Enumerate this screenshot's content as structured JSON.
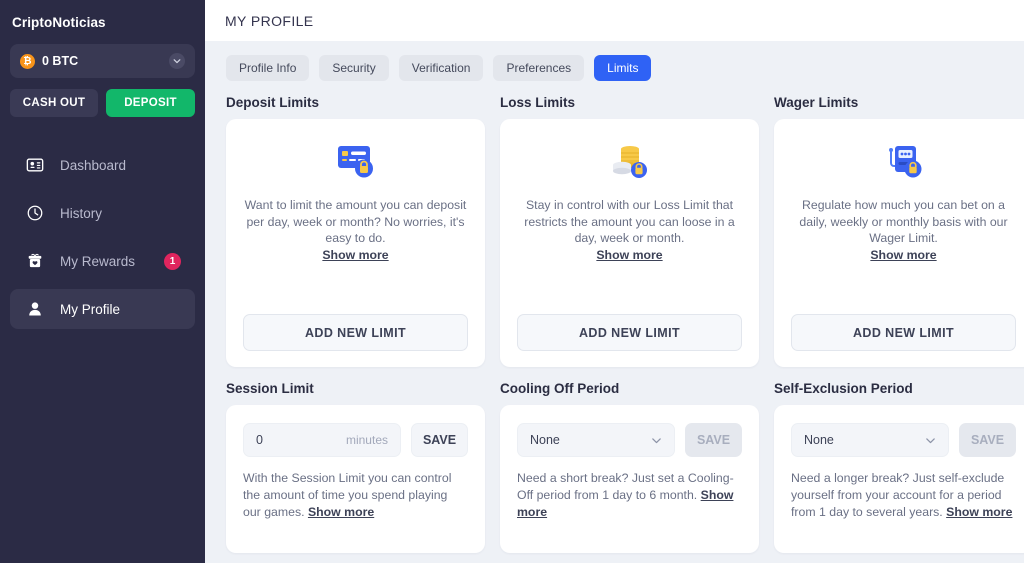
{
  "sidebar": {
    "brand": "CriptoNoticias",
    "balance": {
      "amount": "0 BTC",
      "coin_symbol": "₿",
      "chevron": "chevron-down-icon"
    },
    "actions": {
      "cash_out": "CASH OUT",
      "deposit": "DEPOSIT"
    },
    "items": [
      {
        "label": "Dashboard",
        "icon": "dashboard-icon",
        "active": false,
        "badge": ""
      },
      {
        "label": "History",
        "icon": "clock-icon",
        "active": false,
        "badge": ""
      },
      {
        "label": "My Rewards",
        "icon": "gift-icon",
        "active": false,
        "badge": "1"
      },
      {
        "label": "My Profile",
        "icon": "user-icon",
        "active": true,
        "badge": ""
      }
    ]
  },
  "header": {
    "title": "MY PROFILE"
  },
  "tabs": [
    {
      "label": "Profile Info",
      "active": false
    },
    {
      "label": "Security",
      "active": false
    },
    {
      "label": "Verification",
      "active": false
    },
    {
      "label": "Preferences",
      "active": false
    },
    {
      "label": "Limits",
      "active": true
    }
  ],
  "top_cards": [
    {
      "title": "Deposit Limits",
      "icon": "credit-card-lock-icon",
      "blurb": "Want to limit the amount you can deposit per day, week or month? No worries, it's easy to do.",
      "show_more": "Show more",
      "button": "ADD NEW LIMIT"
    },
    {
      "title": "Loss Limits",
      "icon": "coins-lock-icon",
      "blurb": "Stay in control with our Loss Limit that restricts the amount you can loose in a day, week or month.",
      "show_more": "Show more",
      "button": "ADD NEW LIMIT"
    },
    {
      "title": "Wager Limits",
      "icon": "slot-machine-lock-icon",
      "blurb": "Regulate how much you can bet on a daily, weekly or monthly basis with our Wager Limit.",
      "show_more": "Show more",
      "button": "ADD NEW LIMIT"
    }
  ],
  "bottom_cards": [
    {
      "title": "Session Limit",
      "control": "input",
      "value": "0",
      "unit": "minutes",
      "save_label": "SAVE",
      "save_disabled": false,
      "note": "With the Session Limit you can control the amount of time you spend playing our games.",
      "show_more": "Show more"
    },
    {
      "title": "Cooling Off Period",
      "control": "select",
      "value": "None",
      "unit": "",
      "save_label": "SAVE",
      "save_disabled": true,
      "note": "Need a short break? Just set a Cooling-Off period from 1 day to 6 month.",
      "show_more": "Show more"
    },
    {
      "title": "Self-Exclusion Period",
      "control": "select",
      "value": "None",
      "unit": "",
      "save_label": "SAVE",
      "save_disabled": true,
      "note": "Need a longer break? Just self-exclude yourself from your account for a period from 1 day to several years.",
      "show_more": "Show more"
    }
  ],
  "colors": {
    "sidebar_bg": "#2b2b45",
    "accent_blue": "#2f62f5",
    "deposit_green": "#12b76a",
    "badge_red": "#e0255e",
    "page_bg": "#eef1f6",
    "bitcoin_orange": "#f7931a"
  }
}
